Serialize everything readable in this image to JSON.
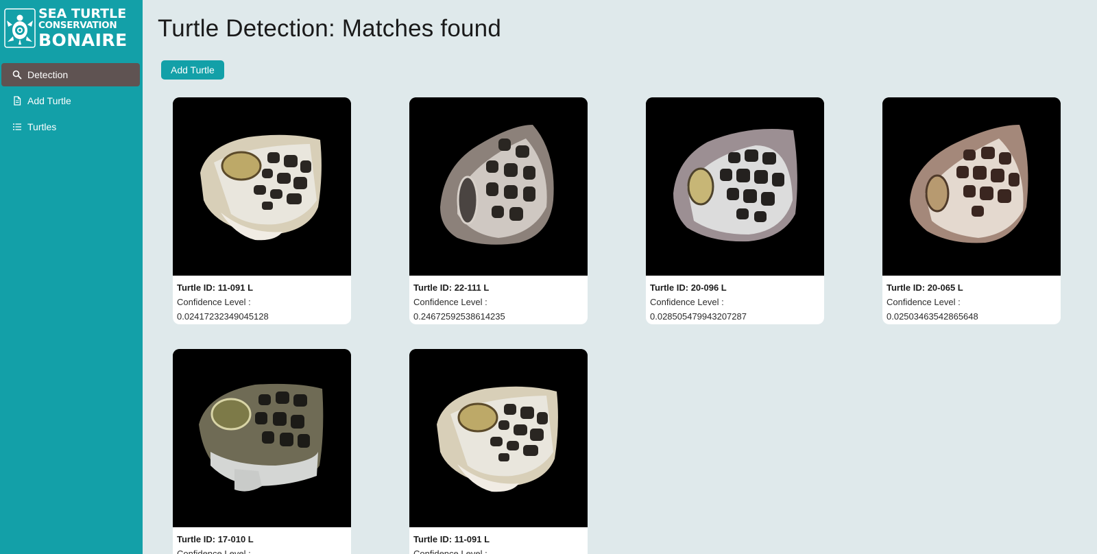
{
  "sidebar": {
    "logo": {
      "line1": "Sea Turtle",
      "line2": "Conservation",
      "line3": "Bonaire",
      "icon": "turtle-logo-icon"
    },
    "items": [
      {
        "label": "Detection",
        "icon": "search-icon",
        "active": true
      },
      {
        "label": "Add Turtle",
        "icon": "document-icon",
        "active": false
      },
      {
        "label": "Turtles",
        "icon": "list-icon",
        "active": false
      }
    ]
  },
  "main": {
    "title": "Turtle Detection: Matches found",
    "add_button_label": "Add Turtle",
    "confidence_label": "Confidence Level :",
    "id_prefix": "Turtle ID:",
    "cards": [
      {
        "turtle_id": "Turtle ID: 11-091 L",
        "confidence_label": "Confidence Level :",
        "confidence": "0.02417232349045128"
      },
      {
        "turtle_id": "Turtle ID: 22-111 L",
        "confidence_label": "Confidence Level :",
        "confidence": "0.24672592538614235"
      },
      {
        "turtle_id": "Turtle ID: 20-096 L",
        "confidence_label": "Confidence Level :",
        "confidence": "0.028505479943207287"
      },
      {
        "turtle_id": "Turtle ID: 20-065 L",
        "confidence_label": "Confidence Level :",
        "confidence": "0.02503463542865648"
      },
      {
        "turtle_id": "Turtle ID: 17-010 L",
        "confidence_label": "Confidence Level :",
        "confidence": ""
      },
      {
        "turtle_id": "Turtle ID: 11-091 L",
        "confidence_label": "Confidence Level :",
        "confidence": ""
      }
    ]
  },
  "colors": {
    "accent": "#13a0a8",
    "active_nav": "#5f5352",
    "background": "#dfe9eb"
  }
}
